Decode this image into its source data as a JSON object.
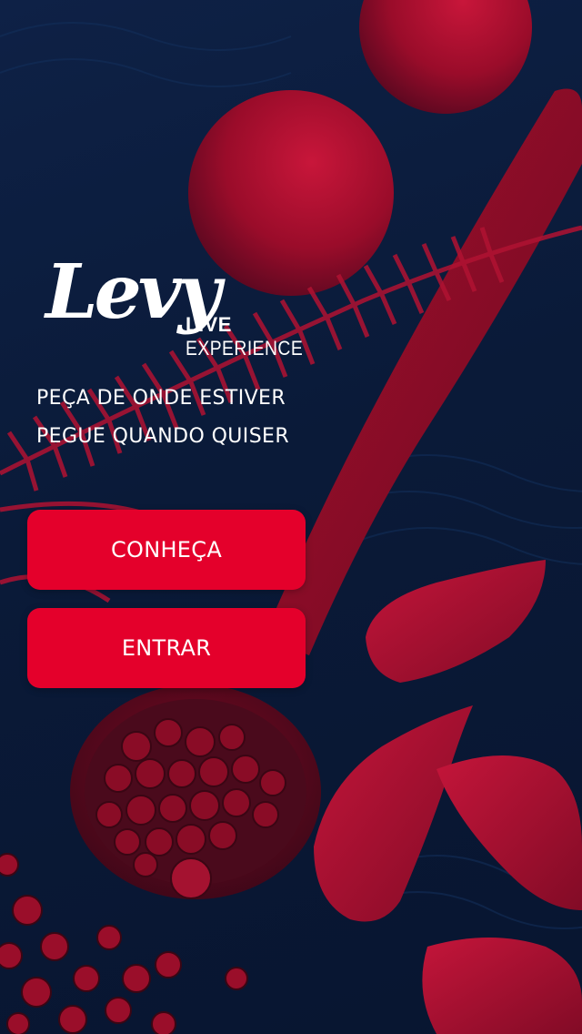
{
  "app": {
    "logo": {
      "wordmark": "Levy",
      "live": "LIVE",
      "experience": "EXPERIENCE"
    },
    "tagline": {
      "line1": "PEÇA DE ONDE ESTIVER",
      "line2": "PEGUE QUANDO QUISER"
    },
    "buttons": {
      "discover_label": "CONHEÇA",
      "login_label": "ENTRAR"
    },
    "colors": {
      "background": "#0b1a36",
      "accent": "#e4002b",
      "art_red": "#b0102a",
      "text": "#ffffff"
    },
    "background_art": "spices-on-wooden-spoon-photo"
  }
}
